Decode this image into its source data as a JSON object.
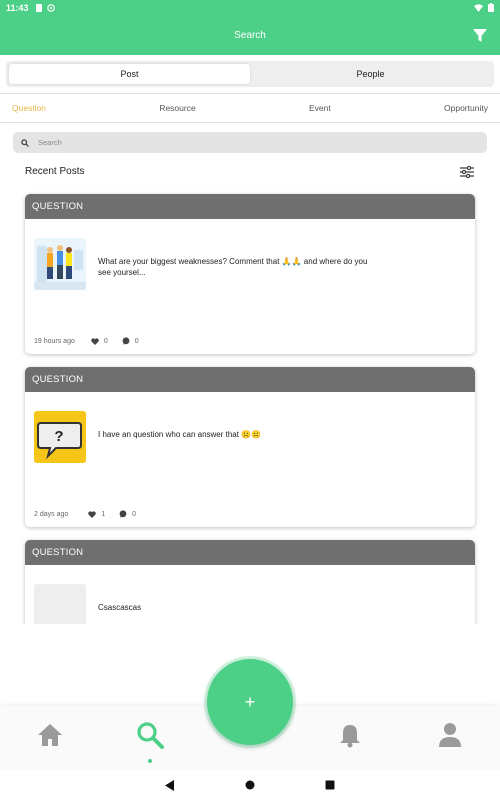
{
  "status_bar": {
    "time": "11:43"
  },
  "header": {
    "title": "Search"
  },
  "segments": [
    {
      "label": "Post",
      "active": true
    },
    {
      "label": "People",
      "active": false
    }
  ],
  "categories": [
    {
      "label": "Question",
      "active": true
    },
    {
      "label": "Resource",
      "active": false
    },
    {
      "label": "Event",
      "active": false
    },
    {
      "label": "Opportunity",
      "active": false
    }
  ],
  "search": {
    "placeholder": "Search"
  },
  "section": {
    "title": "Recent Posts"
  },
  "posts": [
    {
      "type": "QUESTION",
      "text": "What are your biggest weaknesses? Comment that 🙏🙏 and where do you see yoursel...",
      "time": "19 hours ago",
      "likes": "0",
      "comments": "0",
      "thumbnail": "team-illustration"
    },
    {
      "type": "QUESTION",
      "text": "I have an question who can answer that ☹️☹️",
      "time": "2 days ago",
      "likes": "1",
      "comments": "0",
      "thumbnail": "question-bubble"
    },
    {
      "type": "QUESTION",
      "text": "Csascascas",
      "time": "",
      "likes": "",
      "comments": "",
      "thumbnail": "blank"
    }
  ],
  "fab": {
    "label": "+"
  },
  "colors": {
    "brand": "#4ccf86",
    "card_header": "#6f6f6f",
    "active_category": "#e8b84a"
  }
}
